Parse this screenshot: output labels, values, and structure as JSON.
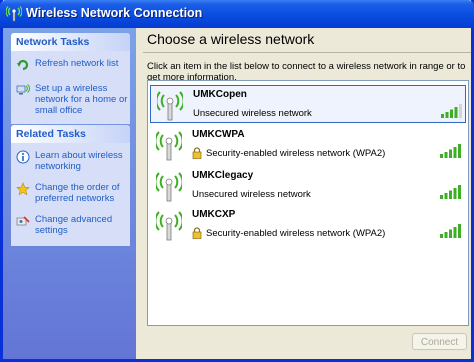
{
  "window": {
    "title": "Wireless Network Connection"
  },
  "sidebar": {
    "network_tasks": {
      "header": "Network Tasks",
      "items": [
        {
          "label": "Refresh network list",
          "icon": "refresh-icon"
        },
        {
          "label": "Set up a wireless network for a home or small office",
          "icon": "setup-network-icon"
        }
      ]
    },
    "related_tasks": {
      "header": "Related Tasks",
      "items": [
        {
          "label": "Learn about wireless networking",
          "icon": "info-icon"
        },
        {
          "label": "Change the order of preferred networks",
          "icon": "star-icon"
        },
        {
          "label": "Change advanced settings",
          "icon": "settings-icon"
        }
      ]
    }
  },
  "main": {
    "title": "Choose a wireless network",
    "instruction": "Click an item in the list below to connect to a wireless network in range or to get more information.",
    "networks": [
      {
        "ssid": "UMKCopen",
        "security": "Unsecured wireless network",
        "secured": false,
        "signal_bars": 5,
        "signal_bars_lit": 4,
        "selected": true
      },
      {
        "ssid": "UMKCWPA",
        "security": "Security-enabled wireless network (WPA2)",
        "secured": true,
        "signal_bars": 5,
        "signal_bars_lit": 5,
        "selected": false
      },
      {
        "ssid": "UMKClegacy",
        "security": "Unsecured wireless network",
        "secured": false,
        "signal_bars": 5,
        "signal_bars_lit": 5,
        "selected": false
      },
      {
        "ssid": "UMKCXP",
        "security": "Security-enabled wireless network (WPA2)",
        "secured": true,
        "signal_bars": 5,
        "signal_bars_lit": 5,
        "selected": false
      }
    ],
    "connect_button": "Connect"
  },
  "colors": {
    "titlebar": "#0a4fe0",
    "sidebar_bg": "#7ba2e7",
    "task_link": "#215dc6",
    "signal_green": "#3cb022"
  }
}
